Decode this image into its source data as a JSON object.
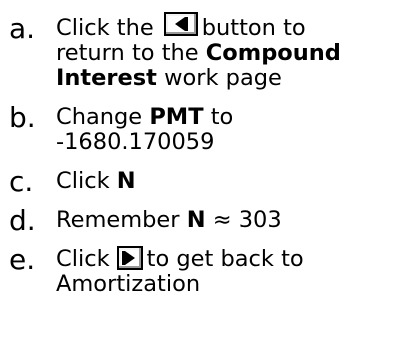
{
  "steps": [
    {
      "marker": "a.",
      "line1_pre": "Click the",
      "back_button_icon": "left-triangle-icon",
      "line1_post": "button to",
      "line2_pre": "return to the",
      "line2_bold": "Compound",
      "line3_bold": "Interest",
      "line3_post": "work page"
    },
    {
      "marker": "b.",
      "line1_pre": "Change",
      "line1_bold": "PMT",
      "line1_post": "to",
      "line2": "-1680.170059"
    },
    {
      "marker": "c.",
      "pre": "Click",
      "bold": "N"
    },
    {
      "marker": "d.",
      "pre": "Remember",
      "bold": "N",
      "post": "≈ 303"
    },
    {
      "marker": "e.",
      "line1_pre": "Click",
      "forward_button_icon": "right-triangle-icon",
      "line1_post": "to get back to",
      "line2": "Amortization"
    }
  ]
}
